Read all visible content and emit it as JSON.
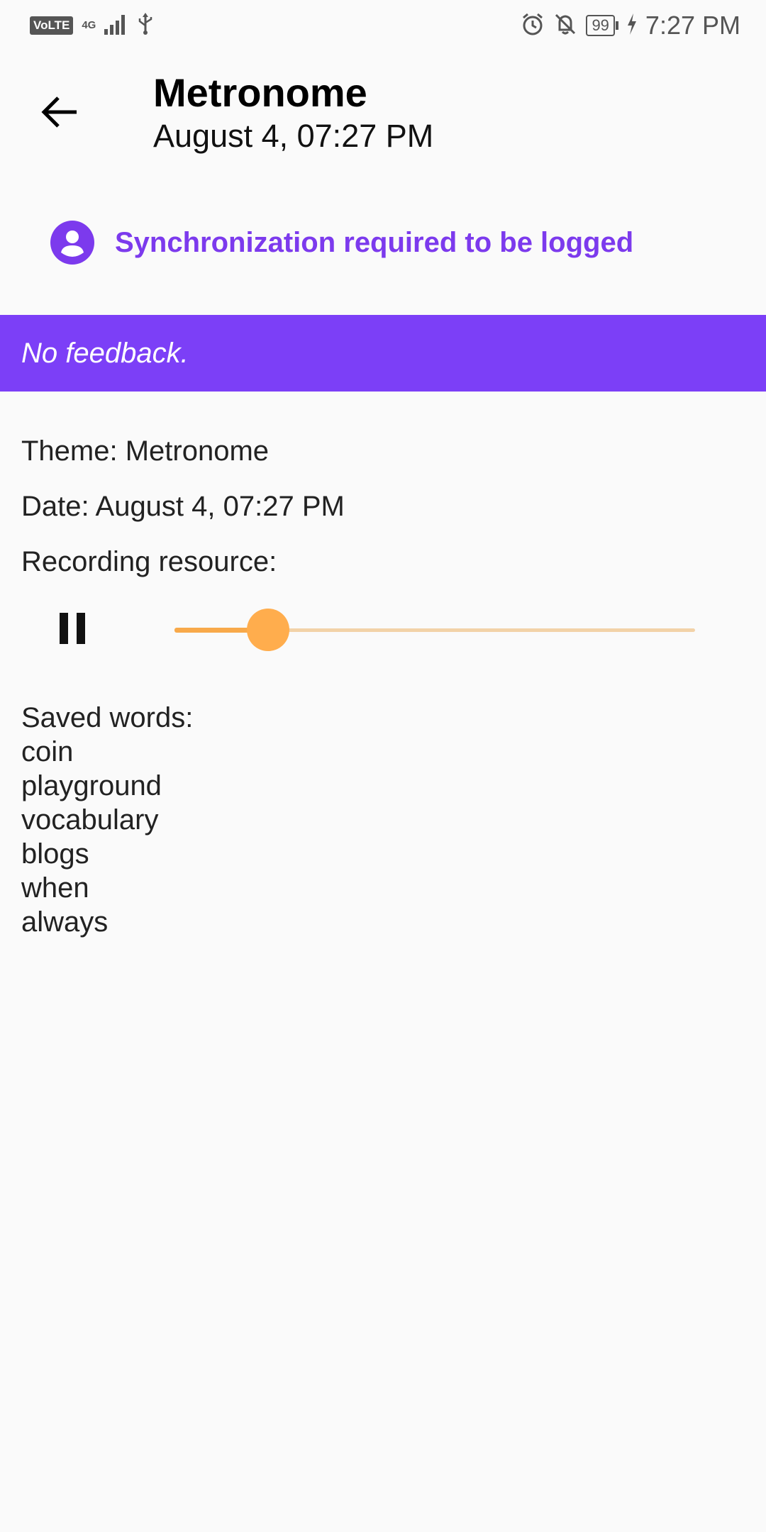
{
  "status_bar": {
    "volte": "VoLTE",
    "network": "4G",
    "battery": "99",
    "time": "7:27 PM"
  },
  "header": {
    "title": "Metronome",
    "subtitle": "August 4, 07:27 PM"
  },
  "sync": {
    "text": "Synchronization required to be logged"
  },
  "banner": {
    "text": "No feedback."
  },
  "details": {
    "theme": "Theme: Metronome",
    "date": "Date: August 4, 07:27 PM",
    "recording_label": "Recording resource:"
  },
  "player": {
    "progress_fraction": 0.18
  },
  "saved_words": {
    "label": "Saved words:",
    "items": [
      "coin",
      "playground",
      "vocabulary",
      "blogs",
      "when",
      "always"
    ]
  },
  "colors": {
    "accent": "#7c3ff7",
    "slider_active": "#ffad4d",
    "slider_inactive": "#f2d2a8"
  }
}
